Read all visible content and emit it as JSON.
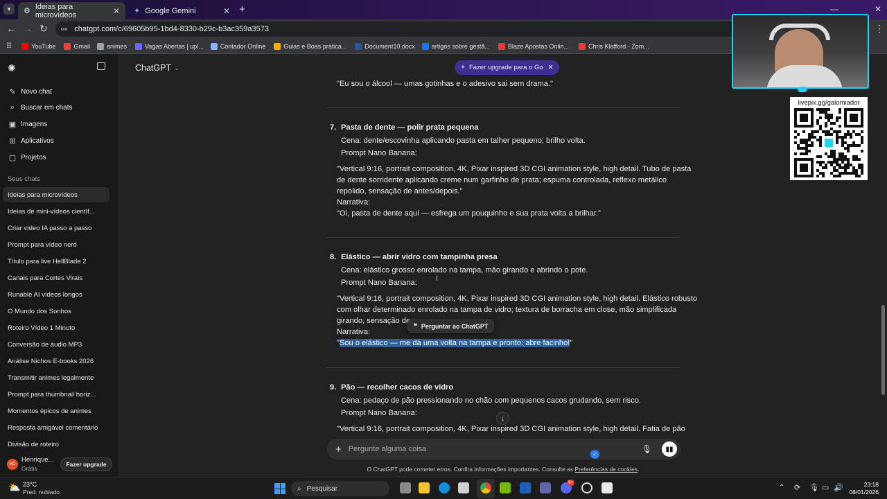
{
  "browser": {
    "tabs": [
      {
        "label": "Ideias para microvídeos",
        "active": true
      },
      {
        "label": "Google Gemini",
        "active": false
      }
    ],
    "url": "chatgpt.com/c/69605b95-1bd4-8330-b29c-b3ac359a3573",
    "bookmarks": [
      "YouTube",
      "Gmail",
      "animes",
      "Vagas Abertas | upl...",
      "Contador Online",
      "Guias e Boas prática...",
      "Document10.docx",
      "artigos sobre gestã...",
      "Blaze Apostas Onlin...",
      "Chris Klafford - Zom..."
    ],
    "bookmark_colors": [
      "#ff0000",
      "#ea4335",
      "#9aa0a6",
      "#6c63ff",
      "#8ab4f8",
      "#f9ab00",
      "#2b579a",
      "#1a73e8",
      "#e53935",
      "#e53935"
    ]
  },
  "sidebar": {
    "nav": [
      {
        "label": "Novo chat",
        "icon": "edit-icon"
      },
      {
        "label": "Buscar em chats",
        "icon": "search-icon"
      },
      {
        "label": "Imagens",
        "icon": "image-icon"
      },
      {
        "label": "Aplicativos",
        "icon": "apps-icon"
      },
      {
        "label": "Projetos",
        "icon": "folder-icon"
      }
    ],
    "section_label": "Seus chats",
    "chats": [
      "Ideias para microvídeos",
      "Ideias de mini-vídeos científ...",
      "Criar vídeo IA passo a passo",
      "Prompt para vídeo nerd",
      "Título para live HellBlade 2",
      "Canais para Cortes Virais",
      "Runable AI vídeos longos",
      "O Mundo dos Sonhos",
      "Roteiro Vídeo 1 Minuto",
      "Conversão de áudio MP3",
      "Análise Nichos E-books 2026",
      "Transmitir animes legalmente",
      "Prompt para thumbnail horiz...",
      "Momentos épicos de animes",
      "Resposta amigável comentário",
      "Divisão de roteiro"
    ],
    "user": {
      "initials": "HD",
      "name": "Henrique...",
      "plan": "Grátis",
      "upgrade_label": "Fazer upgrade"
    }
  },
  "header": {
    "model_label": "ChatGPT",
    "upgrade_pill": "Fazer upgrade para o Go"
  },
  "conversation": {
    "prev_quote": "\"Eu sou o álcool — umas gotinhas e o adesivo sai sem drama.\"",
    "items": [
      {
        "number": "7.",
        "title": "Pasta de dente — polir prata pequena",
        "scene": "Cena: dente/escovinha aplicando pasta em talher pequeno; brilho volta.",
        "prompt_label": "Prompt Nano Banana:",
        "prompt_lines": [
          "\"Vertical 9:16, portrait composition, 4K, Pixar inspired 3D CGI animation style, high detail. Tubo de pasta",
          "de dente sorridente aplicando creme num garfinho de prata; espuma controlada, reflexo metálico",
          "repolido, sensação de antes/depois.\""
        ],
        "narrative_label": "Narrativa:",
        "narrative": "\"Oi, pasta de dente aqui — esfrega um pouquinho e sua prata volta a brilhar.\""
      },
      {
        "number": "8.",
        "title": "Elástico — abrir vidro com tampinha presa",
        "scene": "Cena: elástico grosso enrolado na tampa, mão girando e abrindo o pote.",
        "prompt_label": "Prompt Nano Banana:",
        "prompt_lines": [
          "\"Vertical 9:16, portrait composition, 4K, Pixar inspired 3D CGI animation style, high detail. Elástico robusto",
          "com olhar determinado enrolado na tampa de vidro; textura de borracha em close, mão simplificada",
          "girando, sensação de"
        ],
        "narrative_label": "Narrativa:",
        "narrative_open": "\"",
        "narrative_selected": "Sou o elástico — me dá uma volta na tampa e pronto: abre facinho!",
        "narrative_close": "\""
      },
      {
        "number": "9.",
        "title": "Pão — recolher cacos de vidro",
        "scene": "Cena: pedaço de pão pressionando no chão com pequenos cacos grudando, sem risco.",
        "prompt_label": "Prompt Nano Banana:",
        "prompt_lines": [
          "\"Vertical 9:16, portrait composition, 4K, Pixar inspired 3D CGI animation style, high detail. Fatia de pão"
        ]
      }
    ],
    "ask_tooltip": "Perguntar ao ChatGPT"
  },
  "composer": {
    "placeholder": "Pergunte alguma coisa",
    "disclaimer_prefix": "O ChatGPT pode cometer erros. Confira informações importantes. Consulte as ",
    "disclaimer_link": "Preferências de cookies",
    "disclaimer_suffix": "."
  },
  "overlay": {
    "qr_url": "livepix.gg/galomiador"
  },
  "taskbar": {
    "weather_temp": "23°C",
    "weather_desc": "Pred. nublado",
    "search_label": "Pesquisar",
    "time": "23:18",
    "date": "08/01/2026",
    "discord_badge": "9+"
  },
  "colors": {
    "accent_pill": "#3c2f8f",
    "selection": "#2f5f98",
    "cam_border": "#22d3ee"
  }
}
